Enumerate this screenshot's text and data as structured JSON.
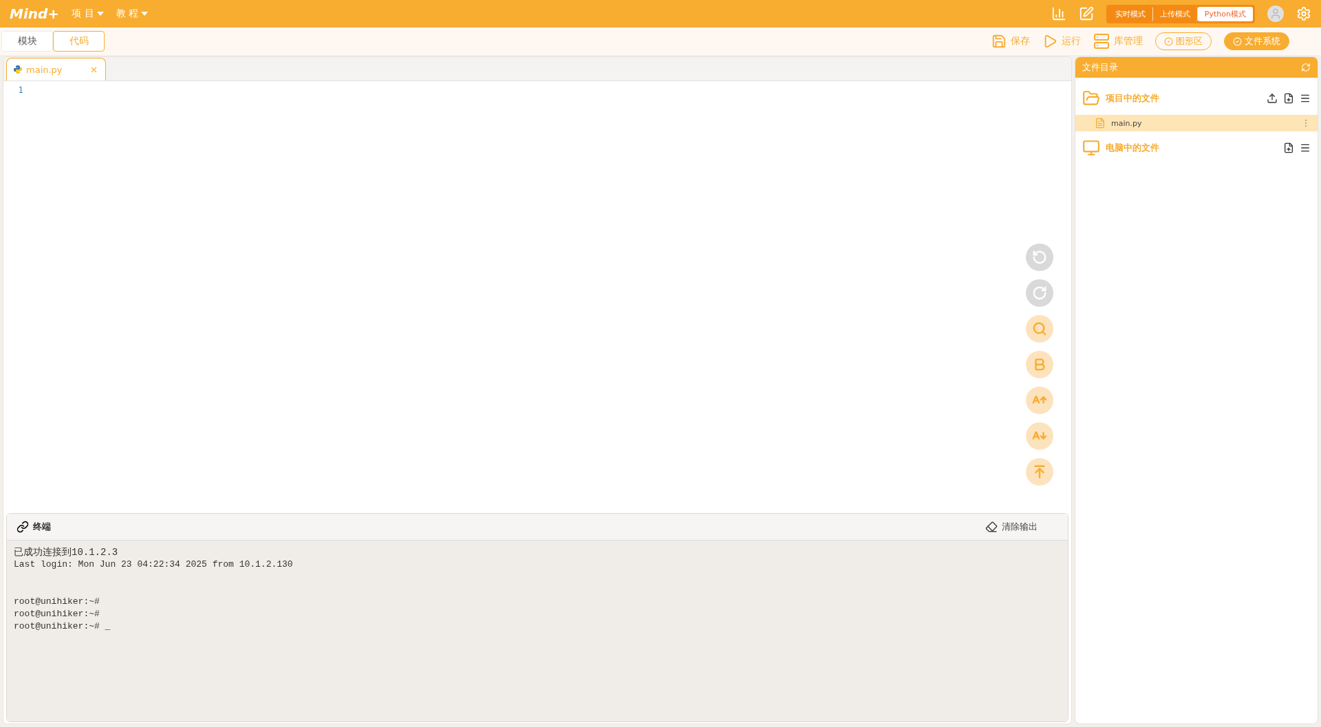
{
  "app_bar": {
    "logo_text": "Mind+",
    "menus": [
      {
        "label": "项 目"
      },
      {
        "label": "教 程"
      }
    ],
    "modes": [
      {
        "label": "实时模式",
        "selected": false
      },
      {
        "label": "上传模式",
        "selected": false
      },
      {
        "label": "Python模式",
        "selected": true
      }
    ]
  },
  "view_tabs": [
    {
      "label": "模块",
      "selected": false
    },
    {
      "label": "代码",
      "selected": true
    }
  ],
  "toolbar": [
    {
      "kind": "save",
      "label": "保存"
    },
    {
      "kind": "run",
      "label": "运行"
    },
    {
      "kind": "library",
      "label": "库管理"
    },
    {
      "kind": "outline",
      "label": "图形区"
    },
    {
      "kind": "filled",
      "label": "文件系统"
    }
  ],
  "editor": {
    "tabs": [
      {
        "label": "main.py",
        "selected": true
      }
    ],
    "line_numbers": [
      "1"
    ],
    "tools": [
      {
        "kind": "undo",
        "disabled": true
      },
      {
        "kind": "redo",
        "disabled": true
      },
      {
        "kind": "search",
        "disabled": false
      },
      {
        "kind": "bold",
        "disabled": false
      },
      {
        "kind": "font-up",
        "disabled": false
      },
      {
        "kind": "font-down",
        "disabled": false
      },
      {
        "kind": "top",
        "disabled": false
      }
    ]
  },
  "terminal": {
    "title": "终端",
    "clear_button": "清除输出",
    "blocks": [
      [
        "已成功连接到10.1.2.3",
        "Last login: Mon Jun 23 04:22:34 2025 from 10.1.2.130"
      ],
      [
        "root@unihiker:~#",
        "root@unihiker:~#",
        "root@unihiker:~# _"
      ]
    ]
  },
  "file_panel": {
    "title": "文件目录",
    "sections": [
      {
        "kind": "project",
        "title": "项目中的文件",
        "files": [
          {
            "name": "main.py",
            "selected": true
          }
        ]
      },
      {
        "kind": "computer",
        "title": "电脑中的文件"
      }
    ]
  }
}
